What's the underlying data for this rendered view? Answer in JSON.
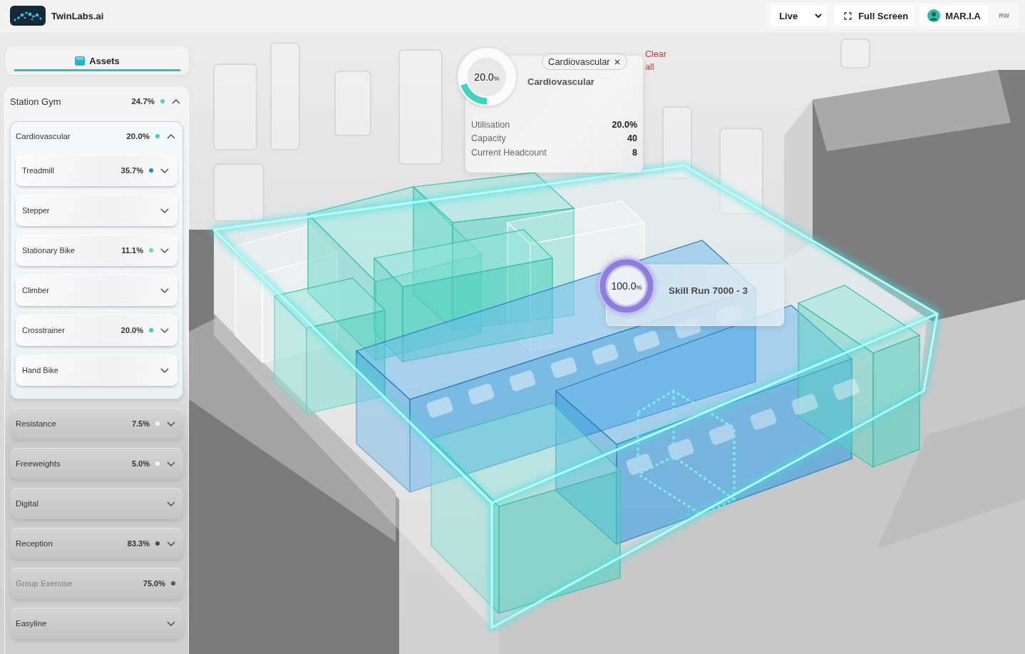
{
  "header": {
    "brand": "TwinLabs.ai",
    "mode_select": {
      "value": "Live"
    },
    "fullscreen_button": {
      "label": "Full Screen"
    },
    "user_button": {
      "label": "MAR.I.A"
    },
    "access_label": "RW"
  },
  "sidebar": {
    "tabs": [
      {
        "label": "Assets",
        "selected": true
      }
    ],
    "tree": [
      {
        "name": "Station Gym",
        "reading": "24.7%",
        "color": "#4fd0c6",
        "expanded": true,
        "disabled": false,
        "children": [
          {
            "name": "Cardiovascular",
            "reading": "20.0%",
            "color": "#45cfc3",
            "expanded": true,
            "disabled": false,
            "children": [
              {
                "name": "Treadmill",
                "reading": "35.7%",
                "color": "#2185d0",
                "expanded": false,
                "disabled": false
              },
              {
                "name": "Stepper",
                "expanded": false,
                "disabled": false
              },
              {
                "name": "Stationary Bike",
                "reading": "11.1%",
                "color": "#68d8c8",
                "expanded": false,
                "disabled": false
              },
              {
                "name": "Climber",
                "expanded": false,
                "disabled": false
              },
              {
                "name": "Crosstrainer",
                "reading": "20.0%",
                "color": "#3cd0c4",
                "expanded": false,
                "disabled": false
              },
              {
                "name": "Hand Bike",
                "expanded": false,
                "disabled": false
              }
            ]
          },
          {
            "name": "Resistance",
            "reading": "7.5%",
            "color": "#f4f4f4",
            "expanded": false,
            "disabled": false
          },
          {
            "name": "Freeweights",
            "reading": "5.0%",
            "color": "#f6f6f6",
            "expanded": false,
            "disabled": false
          },
          {
            "name": "Digital",
            "expanded": false,
            "disabled": false
          },
          {
            "name": "Reception",
            "reading": "83.3%",
            "color": "#4a4a4a",
            "expanded": false,
            "disabled": false
          },
          {
            "name": "Group Exercise",
            "reading": "75.0%",
            "color": "#5a5a5a",
            "disabled": true
          },
          {
            "name": "Easyline",
            "expanded": false,
            "disabled": false
          }
        ]
      }
    ]
  },
  "zone_callout": {
    "gauge": {
      "reading": "20.0",
      "unit": "%",
      "level": 0.2
    },
    "filter_chip": {
      "label": "Cardiovascular"
    },
    "clear_link": "Clear all",
    "title": "Cardiovascular",
    "stats": [
      {
        "label": "Utilisation",
        "value": "20.0%"
      },
      {
        "label": "Capacity",
        "value": "40"
      },
      {
        "label": "Current Headcount",
        "value": "8"
      }
    ]
  },
  "asset_callout": {
    "gauge": {
      "reading": "100.0",
      "unit": "%",
      "level": 1
    },
    "title": "Skill Run 7000 - 3"
  }
}
